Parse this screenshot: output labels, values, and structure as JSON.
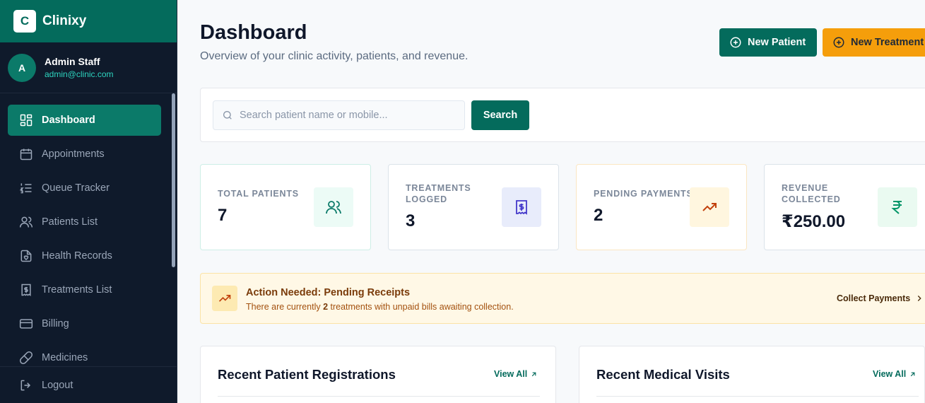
{
  "brand": {
    "logo_letter": "C",
    "name": "Clinixy",
    "color": "#046b5c"
  },
  "user": {
    "initial": "A",
    "name": "Admin Staff",
    "email": "admin@clinic.com"
  },
  "sidebar": {
    "items": [
      {
        "label": "Dashboard",
        "icon": "dashboard-grid-icon",
        "active": true
      },
      {
        "label": "Appointments",
        "icon": "calendar-icon"
      },
      {
        "label": "Queue Tracker",
        "icon": "list-ordered-icon"
      },
      {
        "label": "Patients List",
        "icon": "users-icon"
      },
      {
        "label": "Health Records",
        "icon": "file-heart-icon"
      },
      {
        "label": "Treatments List",
        "icon": "receipt-dollar-icon"
      },
      {
        "label": "Billing",
        "icon": "credit-card-icon"
      },
      {
        "label": "Medicines",
        "icon": "pill-icon"
      }
    ],
    "logout_label": "Logout"
  },
  "header": {
    "title": "Dashboard",
    "subtitle": "Overview of your clinic activity, patients, and revenue.",
    "new_patient_label": "New Patient",
    "new_treatment_label": "New Treatment"
  },
  "search": {
    "placeholder": "Search patient name or mobile...",
    "value": "",
    "button_label": "Search"
  },
  "stats": [
    {
      "label": "TOTAL PATIENTS",
      "value": "7",
      "icon": "users-icon",
      "accent": "#0b7a69"
    },
    {
      "label": "TREATMENTS LOGGED",
      "value": "3",
      "icon": "receipt-dollar-icon",
      "accent": "#4338ca"
    },
    {
      "label": "PENDING PAYMENTS",
      "value": "2",
      "icon": "trending-up-icon",
      "accent": "#c2410c"
    },
    {
      "label": "REVENUE COLLECTED",
      "value": "₹250.00",
      "icon": "rupee-icon",
      "accent": "#059669"
    }
  ],
  "alert": {
    "title": "Action Needed: Pending Receipts",
    "text_before": "There are currently ",
    "count": "2",
    "text_after": " treatments with unpaid bills awaiting collection.",
    "link_label": "Collect Payments"
  },
  "panels": [
    {
      "title": "Recent Patient Registrations",
      "link_label": "View All"
    },
    {
      "title": "Recent Medical Visits",
      "link_label": "View All"
    }
  ]
}
